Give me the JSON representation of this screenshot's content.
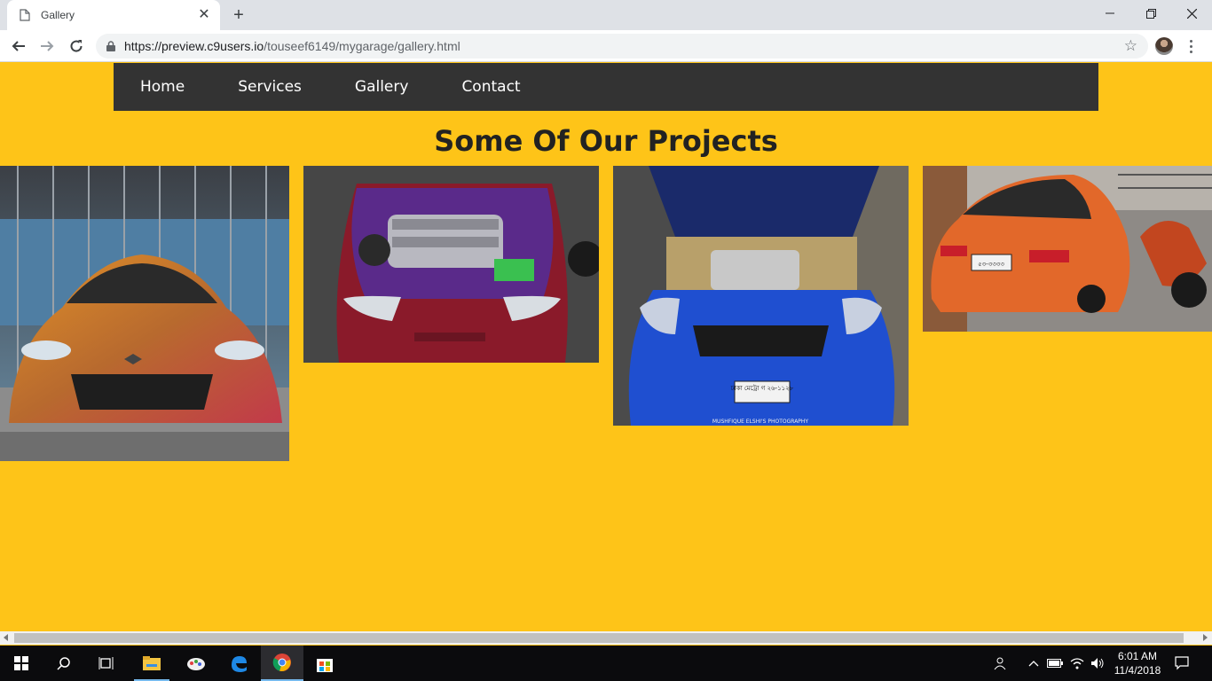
{
  "browser": {
    "tab_title": "Gallery",
    "url_host": "https://preview.c9users.io",
    "url_path": "/touseef6149/mygarage/gallery.html"
  },
  "nav": {
    "items": [
      {
        "label": "Home"
      },
      {
        "label": "Services"
      },
      {
        "label": "Gallery"
      },
      {
        "label": "Contact"
      }
    ]
  },
  "page": {
    "heading": "Some Of Our Projects",
    "background_color": "#fec418",
    "navbar_color": "#333333"
  },
  "gallery": {
    "photos": [
      {
        "subject": "orange-red Mazda RX-8 front view"
      },
      {
        "subject": "red car engine bay with purple accents"
      },
      {
        "subject": "blue Toyota with open hood",
        "caption": "MUSHFIQUE ELSHI'S PHOTOGRAPHY",
        "plate": "ঢাকা মেট্রো গ ২৬-১১২৮"
      },
      {
        "subject": "orange Honda sedan rear view with motorcycle",
        "plate": "৫৩-৩৩৩৩"
      }
    ]
  },
  "taskbar": {
    "time": "6:01 AM",
    "date": "11/4/2018"
  }
}
